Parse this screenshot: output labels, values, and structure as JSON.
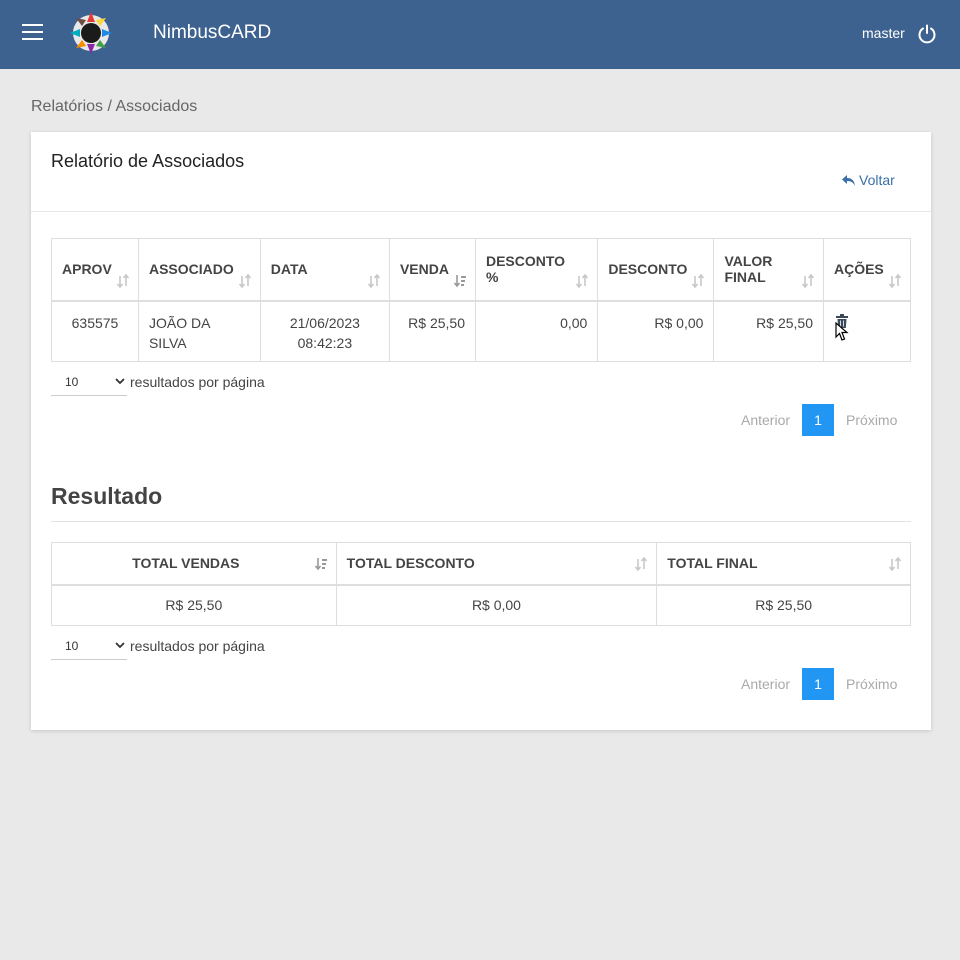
{
  "header": {
    "brand": "NimbusCARD",
    "user": "master",
    "logo_icon": "nimbus-logo",
    "menu_icon": "hamburger-icon",
    "power_icon": "power-icon",
    "bar_color": "#3e6290"
  },
  "breadcrumb": "Relatórios / Associados",
  "card": {
    "title": "Relatório de Associados",
    "back_label": "Voltar"
  },
  "associados_table": {
    "columns": [
      {
        "label": "APROV",
        "label2": ""
      },
      {
        "label": "ASSOCIADO",
        "label2": ""
      },
      {
        "label": "DATA",
        "label2": ""
      },
      {
        "label": "VENDA",
        "label2": ""
      },
      {
        "label": "DESCONTO",
        "label2": "%"
      },
      {
        "label": "DESCONTO",
        "label2": ""
      },
      {
        "label": "VALOR",
        "label2": "FINAL"
      },
      {
        "label": "AÇÕES",
        "label2": ""
      }
    ],
    "rows": [
      {
        "aprov": "635575",
        "associado": "JOÃO DA SILVA",
        "data": "21/06/2023",
        "hora": "08:42:23",
        "venda": "R$ 25,50",
        "desconto_pct": "0,00",
        "desconto": "R$ 0,00",
        "valor_final": "R$ 25,50"
      }
    ],
    "length_value": "10",
    "length_label": "resultados por página",
    "pager": {
      "prev": "Anterior",
      "page": "1",
      "next": "Próximo"
    }
  },
  "resultado": {
    "title": "Resultado",
    "columns": [
      "TOTAL VENDAS",
      "TOTAL DESCONTO",
      "TOTAL FINAL"
    ],
    "rows": [
      {
        "total_vendas": "R$ 25,50",
        "total_desconto": "R$ 0,00",
        "total_final": "R$ 25,50"
      }
    ],
    "length_value": "10",
    "length_label": "resultados por página",
    "pager": {
      "prev": "Anterior",
      "page": "1",
      "next": "Próximo"
    }
  },
  "colors": {
    "accent": "#2196f3",
    "link": "#3a6fa8"
  }
}
